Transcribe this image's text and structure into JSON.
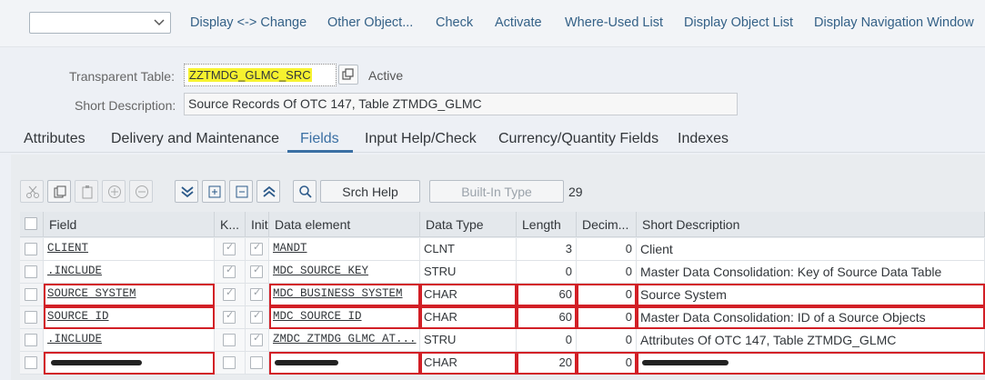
{
  "toolbar": {
    "buttons": [
      "Display <-> Change",
      "Other Object...",
      "Check",
      "Activate",
      "Where-Used List",
      "Display Object List",
      "Display Navigation Window"
    ]
  },
  "header": {
    "table_label": "Transparent Table:",
    "table_value": "ZZTMDG_GLMC_SRC",
    "status": "Active",
    "desc_label": "Short Description:",
    "desc_value": "Source Records Of OTC 147, Table ZTMDG_GLMC"
  },
  "tabs": [
    "Attributes",
    "Delivery and Maintenance",
    "Fields",
    "Input Help/Check",
    "Currency/Quantity Fields",
    "Indexes"
  ],
  "active_tab": "Fields",
  "grid_toolbar": {
    "srch_help": "Srch Help",
    "builtin_type": "Built-In Type",
    "row_count": "29"
  },
  "columns": [
    "Field",
    "K...",
    "Initi...",
    "Data element",
    "Data Type",
    "Length",
    "Decim...",
    "Short Description"
  ],
  "rows": [
    {
      "field": "CLIENT",
      "key": true,
      "init": true,
      "element": "MANDT",
      "type": "CLNT",
      "length": "3",
      "dec": "0",
      "desc": "Client"
    },
    {
      "field": ".INCLUDE",
      "key": true,
      "init": true,
      "element": "MDC_SOURCE_KEY",
      "type": "STRU",
      "length": "0",
      "dec": "0",
      "desc": "Master Data Consolidation: Key of Source Data Table"
    },
    {
      "field": "SOURCE_SYSTEM",
      "key": true,
      "init": true,
      "element": "MDC_BUSINESS_SYSTEM",
      "type": "CHAR",
      "length": "60",
      "dec": "0",
      "desc": "Source System"
    },
    {
      "field": "SOURCE_ID",
      "key": true,
      "init": true,
      "element": "MDC_SOURCE_ID",
      "type": "CHAR",
      "length": "60",
      "dec": "0",
      "desc": "Master Data Consolidation: ID of a Source Objects"
    },
    {
      "field": ".INCLUDE",
      "key": false,
      "init": true,
      "element": "ZMDC_ZTMDG_GLMC_AT...",
      "type": "STRU",
      "length": "0",
      "dec": "0",
      "desc": "Attributes Of OTC 147, Table ZTMDG_GLMC"
    },
    {
      "field": "",
      "key": false,
      "init": false,
      "element": "",
      "type": "CHAR",
      "length": "20",
      "dec": "0",
      "desc": ""
    }
  ]
}
